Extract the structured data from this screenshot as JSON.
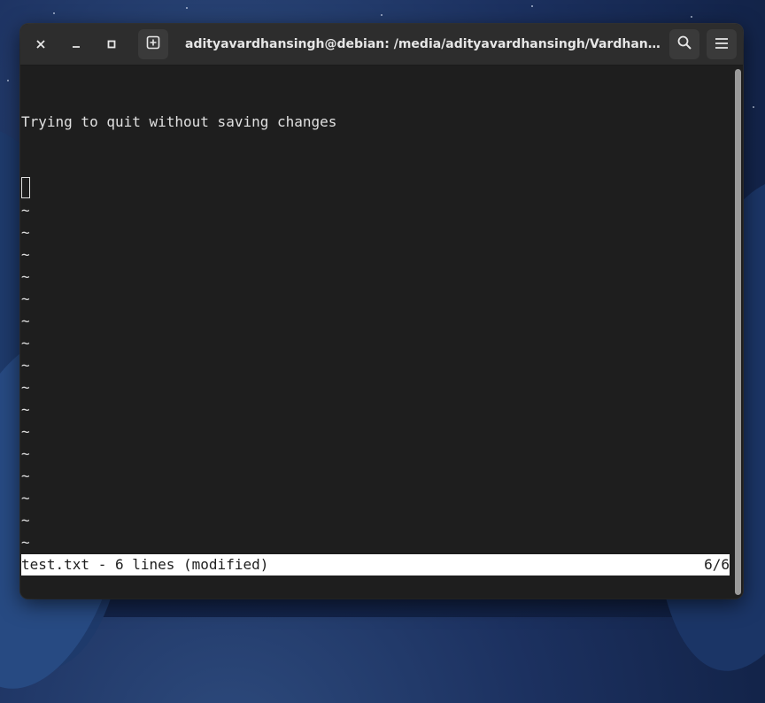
{
  "window": {
    "title": "adityavardhansingh@debian: /media/adityavardhansingh/Vardhan/Other/..."
  },
  "titlebar": {
    "close_icon": "close-icon",
    "minimize_icon": "minimize-icon",
    "maximize_icon": "maximize-icon",
    "new_tab_icon": "new-tab-icon",
    "search_icon": "search-icon",
    "menu_icon": "hamburger-menu-icon"
  },
  "editor": {
    "lines": [
      "",
      "Trying to quit without saving changes",
      "",
      "",
      ""
    ],
    "tilde": "~",
    "tilde_count": 16
  },
  "status": {
    "left": "test.txt - 6 lines (modified)",
    "right": "6/6"
  },
  "colors": {
    "terminal_bg": "#1e1e1e",
    "terminal_fg": "#e0e0e0",
    "headerbar_bg": "#2d2d2d",
    "statusbar_bg": "#ffffff"
  }
}
